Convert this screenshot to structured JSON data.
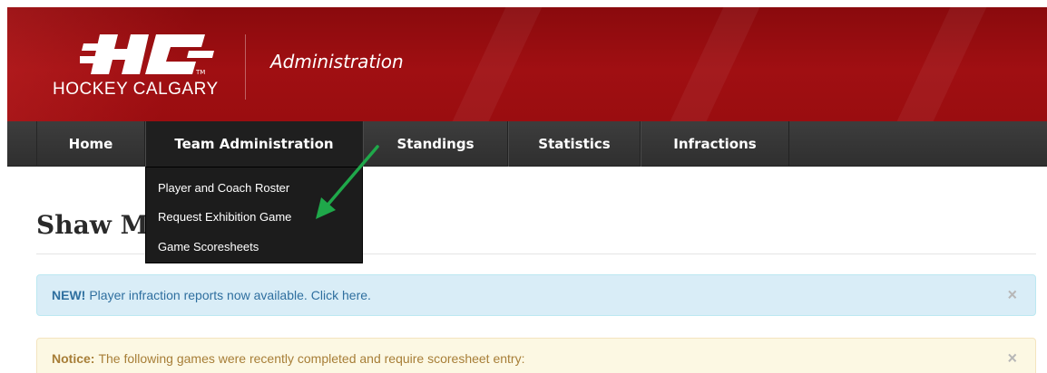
{
  "header": {
    "logo_text": "HOCKEY CALGARY",
    "subtitle": "Administration",
    "colors": {
      "banner": "#9a0d10",
      "navbar": "#353535",
      "dropdown": "#1c1c1c"
    }
  },
  "nav": {
    "items": [
      {
        "label": "Home"
      },
      {
        "label": "Team Administration"
      },
      {
        "label": "Standings"
      },
      {
        "label": "Statistics"
      },
      {
        "label": "Infractions"
      }
    ],
    "dropdown": {
      "items": [
        {
          "label": "Player and Coach Roster"
        },
        {
          "label": "Request Exhibition Game"
        },
        {
          "label": "Game Scoresheets"
        }
      ]
    }
  },
  "page": {
    "title": "Shaw M"
  },
  "alerts": {
    "info": {
      "strong": "NEW!",
      "text": "Player infraction reports now available.",
      "link": "Click here.",
      "close": "×"
    },
    "notice": {
      "strong": "Notice:",
      "text": "The following games were recently completed and require scoresheet entry:",
      "close": "×"
    }
  },
  "annotation": {
    "arrow_color": "#1fa84a",
    "icon": "arrow-pointer-icon"
  }
}
